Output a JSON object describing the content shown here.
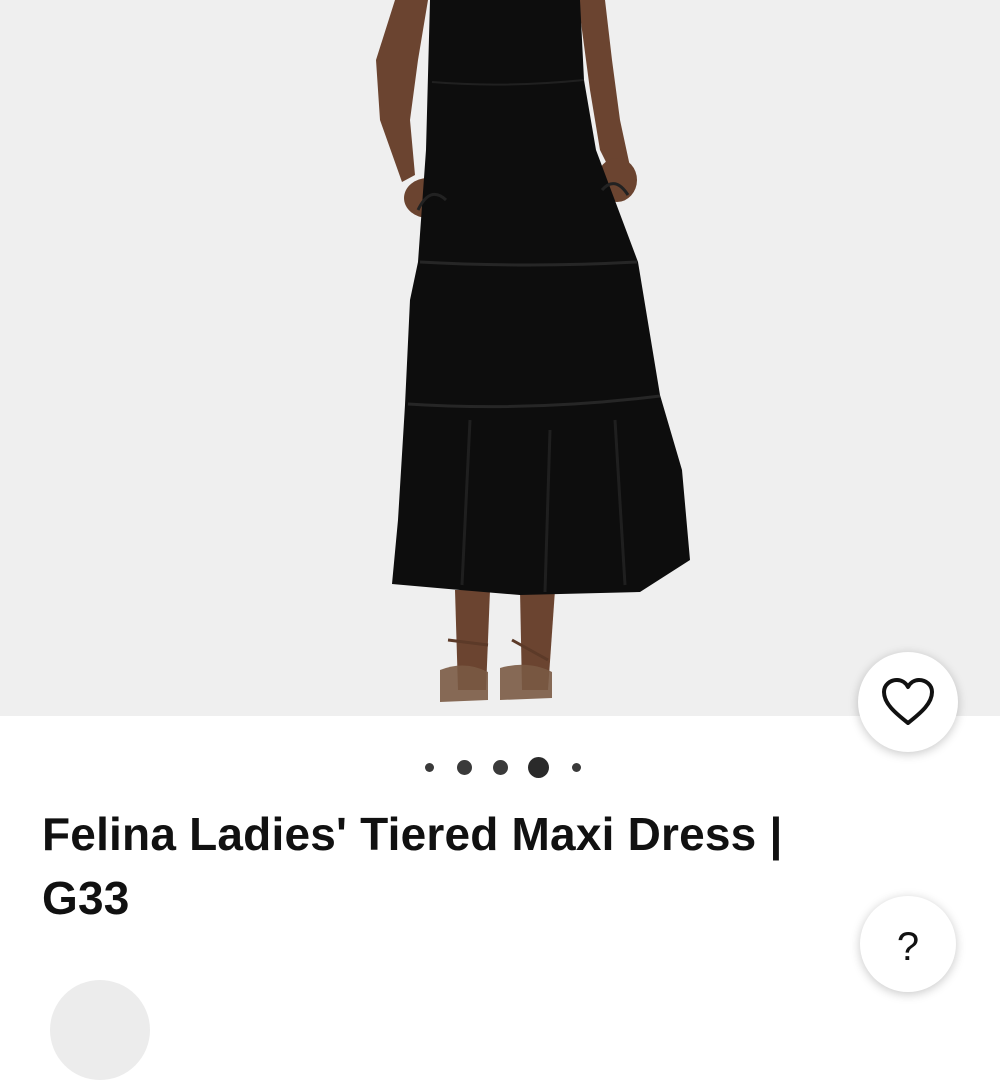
{
  "product": {
    "title_line1": "Felina Ladies' Tiered Maxi Dress |",
    "title_line2": "G33"
  },
  "gallery": {
    "image_count": 5,
    "active_index": 3,
    "image_alt": "Model wearing a black tiered maxi dress with sandals"
  },
  "actions": {
    "favorite_icon": "heart-outline-icon",
    "help_label": "?"
  },
  "colors": {
    "hero_background": "#efefef",
    "dress": "#0d0d0d",
    "skin": "#6b4430",
    "text": "#111111"
  }
}
